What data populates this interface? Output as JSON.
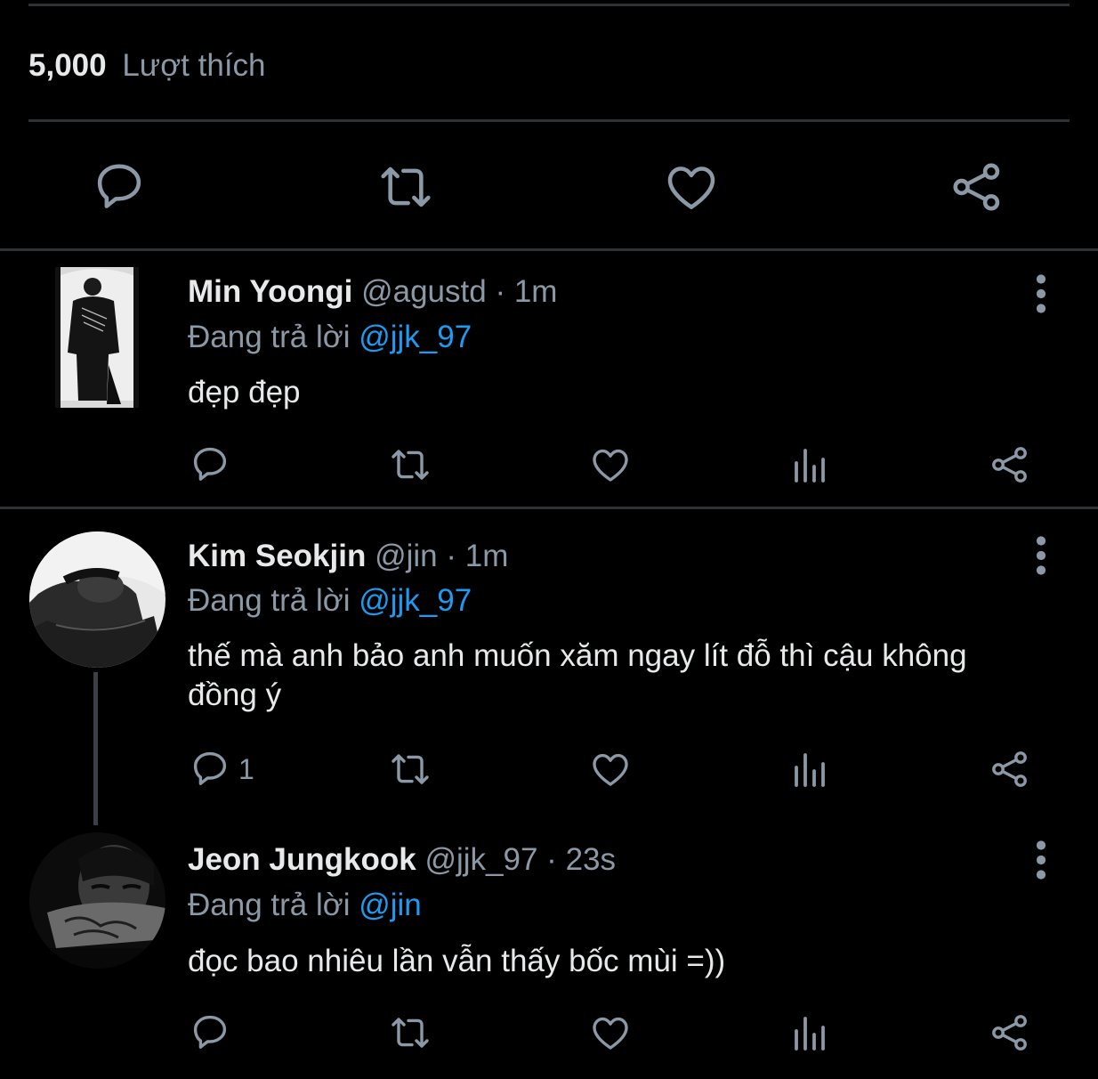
{
  "likes": {
    "count": "5,000",
    "label": "Lượt thích"
  },
  "colors": {
    "background": "#000000",
    "divider": "#2f3336",
    "icon": "#8b98a5",
    "mention": "#1d9bf0",
    "text": "#e7e9ea"
  },
  "main_actions": [
    "reply-icon",
    "retweet-icon",
    "like-icon",
    "share-icon"
  ],
  "tweets": [
    {
      "name": "Min Yoongi",
      "handle": "@agustd",
      "separator": "·",
      "time": "1m",
      "reply_prefix": "Đang trả lời",
      "reply_to": "@jjk_97",
      "text": "đẹp đẹp",
      "reply_count": ""
    },
    {
      "name": "Kim Seokjin",
      "handle": "@jin",
      "separator": "·",
      "time": "1m",
      "reply_prefix": "Đang trả lời",
      "reply_to": "@jjk_97",
      "text": "thế mà anh bảo anh muốn xăm ngay lít đỗ thì cậu không đồng ý",
      "reply_count": "1"
    },
    {
      "name": "Jeon Jungkook",
      "handle": "@jjk_97",
      "separator": "·",
      "time": "23s",
      "reply_prefix": "Đang trả lời",
      "reply_to": "@jin",
      "text": "đọc bao nhiêu lần vẫn thấy bốc mùi =))",
      "reply_count": ""
    }
  ]
}
